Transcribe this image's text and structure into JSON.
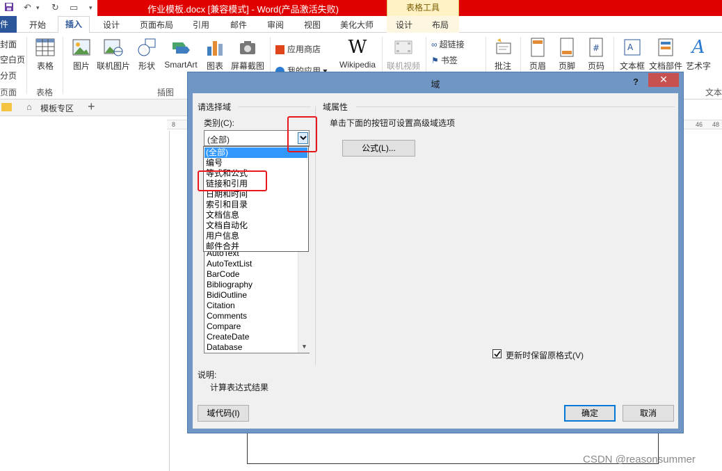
{
  "titlebar": {
    "title": "作业模板.docx [兼容模式] -  Word(产品激活失败)",
    "table_tools": "表格工具",
    "colors": {
      "bar": "#e00000"
    }
  },
  "tabs": {
    "file": "件",
    "items": [
      "开始",
      "插入",
      "设计",
      "页面布局",
      "引用",
      "邮件",
      "审阅",
      "视图",
      "美化大师",
      "设计",
      "布局"
    ]
  },
  "ribbon": {
    "left_partial": [
      "封面",
      "空白页",
      "分页",
      "页面"
    ],
    "table": "表格",
    "picture": "图片",
    "online_picture": "联机图片",
    "shapes": "形状",
    "smartart": "SmartArt",
    "chart": "图表",
    "screenshot": "屏幕截图",
    "app_store": "应用商店",
    "my_apps": "我的应用",
    "wikipedia": "Wikipedia",
    "online_video": "联机视频",
    "hyperlink": "超链接",
    "bookmark": "书签",
    "comment": "批注",
    "header": "页眉",
    "footer": "页脚",
    "page_number": "页码",
    "textbox": "文本框",
    "quick_parts": "文档部件",
    "wordart": "艺术字",
    "text_group": "文本",
    "group_table": "表格",
    "group_illustrations": "插图"
  },
  "doc_tabs": {
    "template_zone": "模板专区",
    "plus": "+"
  },
  "ruler": {
    "left": "8",
    "right1": "46",
    "right2": "48"
  },
  "dialog": {
    "title": "域",
    "help": "?",
    "close": "✕",
    "choose_field": "请选择域",
    "category_label": "类别(C):",
    "category_value": "(全部)",
    "dropdown_options": [
      "(全部)",
      "编号",
      "等式和公式",
      "链接和引用",
      "日期和时间",
      "索引和目录",
      "文档信息",
      "文档自动化",
      "用户信息",
      "邮件合并"
    ],
    "field_names": [
      "AutoText",
      "AutoTextList",
      "BarCode",
      "Bibliography",
      "BidiOutline",
      "Citation",
      "Comments",
      "Compare",
      "CreateDate",
      "Database"
    ],
    "field_properties": "域属性",
    "hint": "单击下面的按钮可设置高级域选项",
    "formula_button": "公式(L)...",
    "preserve_format": "更新时保留原格式(V)",
    "description_label": "说明:",
    "description_text": "计算表达式结果",
    "field_codes_button": "域代码(I)",
    "ok_button": "确定",
    "cancel_button": "取消",
    "colors": {
      "frame": "#6f96c4",
      "selection": "#3399ff",
      "highlight": "#e8161d"
    }
  },
  "watermark": "CSDN @reasonsummer"
}
